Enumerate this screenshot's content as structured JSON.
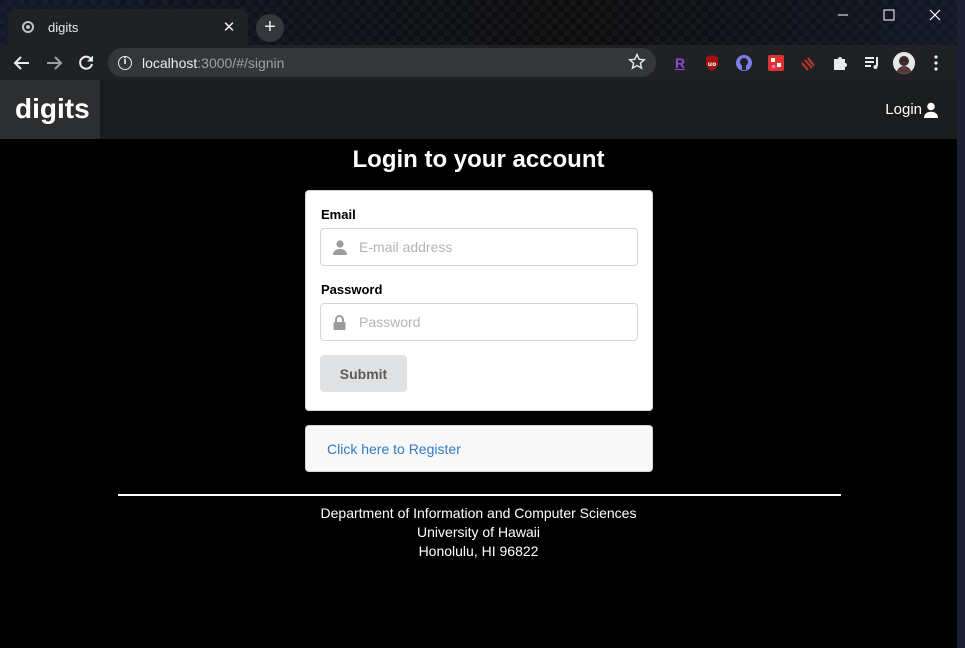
{
  "browser": {
    "tab_title": "digits",
    "tab_close": "✕",
    "new_tab": "+",
    "url_host": "localhost",
    "url_path": ":3000/#/signin",
    "window_controls": [
      "minimize-icon",
      "maximize-icon",
      "close-icon"
    ]
  },
  "navbar": {
    "brand": "digits",
    "login_label": "Login"
  },
  "page": {
    "heading": "Login to your account"
  },
  "form": {
    "email_label": "Email",
    "email_placeholder": "E-mail address",
    "email_value": "",
    "password_label": "Password",
    "password_placeholder": "Password",
    "password_value": "",
    "submit_label": "Submit"
  },
  "register": {
    "link_text": "Click here to Register"
  },
  "footer": {
    "line1": "Department of Information and Computer Sciences",
    "line2": "University of Hawaii",
    "line3": "Honolulu, HI 96822"
  },
  "colors": {
    "page_background": "#000000",
    "navbar_background": "#1b1c1d",
    "brand_background": "#2d2e30",
    "link": "#2e7bc4",
    "submit_background": "#e0e1e2"
  }
}
